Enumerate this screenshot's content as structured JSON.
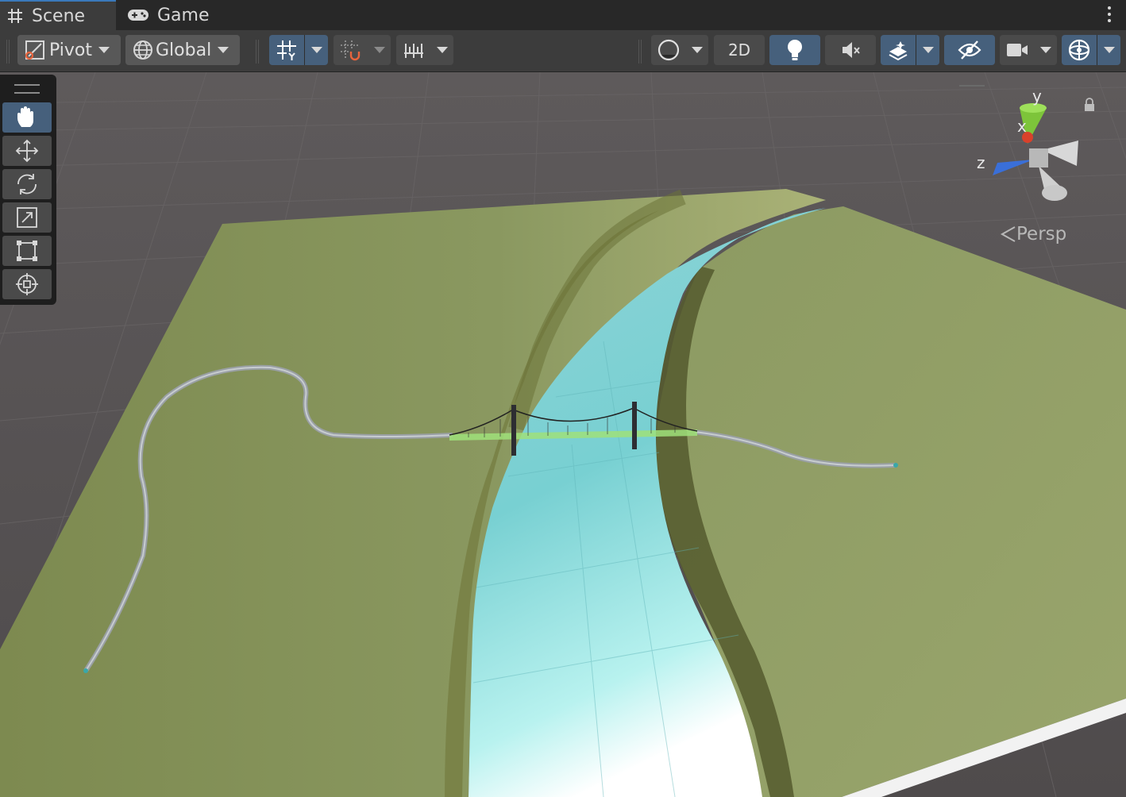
{
  "tabs": [
    {
      "label": "Scene",
      "icon": "hash-grid-icon",
      "active": true
    },
    {
      "label": "Game",
      "icon": "gamepad-icon",
      "active": false
    }
  ],
  "toolbar": {
    "pivot_label": "Pivot",
    "global_label": "Global",
    "mode_2d_label": "2D"
  },
  "tools": [
    {
      "name": "hand-tool",
      "icon": "hand-icon",
      "selected": true
    },
    {
      "name": "move-tool",
      "icon": "move-arrows-icon",
      "selected": false
    },
    {
      "name": "rotate-tool",
      "icon": "rotate-icon",
      "selected": false
    },
    {
      "name": "scale-tool",
      "icon": "scale-icon",
      "selected": false
    },
    {
      "name": "rect-tool",
      "icon": "rect-transform-icon",
      "selected": false
    },
    {
      "name": "transform-tool",
      "icon": "transform-icon",
      "selected": false
    }
  ],
  "gizmo": {
    "y": "y",
    "x": "x",
    "z": "z",
    "projection": "Persp"
  },
  "colors": {
    "terrain": "#8a9a5f",
    "water": "#7ad4d6",
    "ground": "#5a5657",
    "accent": "#46607c"
  }
}
